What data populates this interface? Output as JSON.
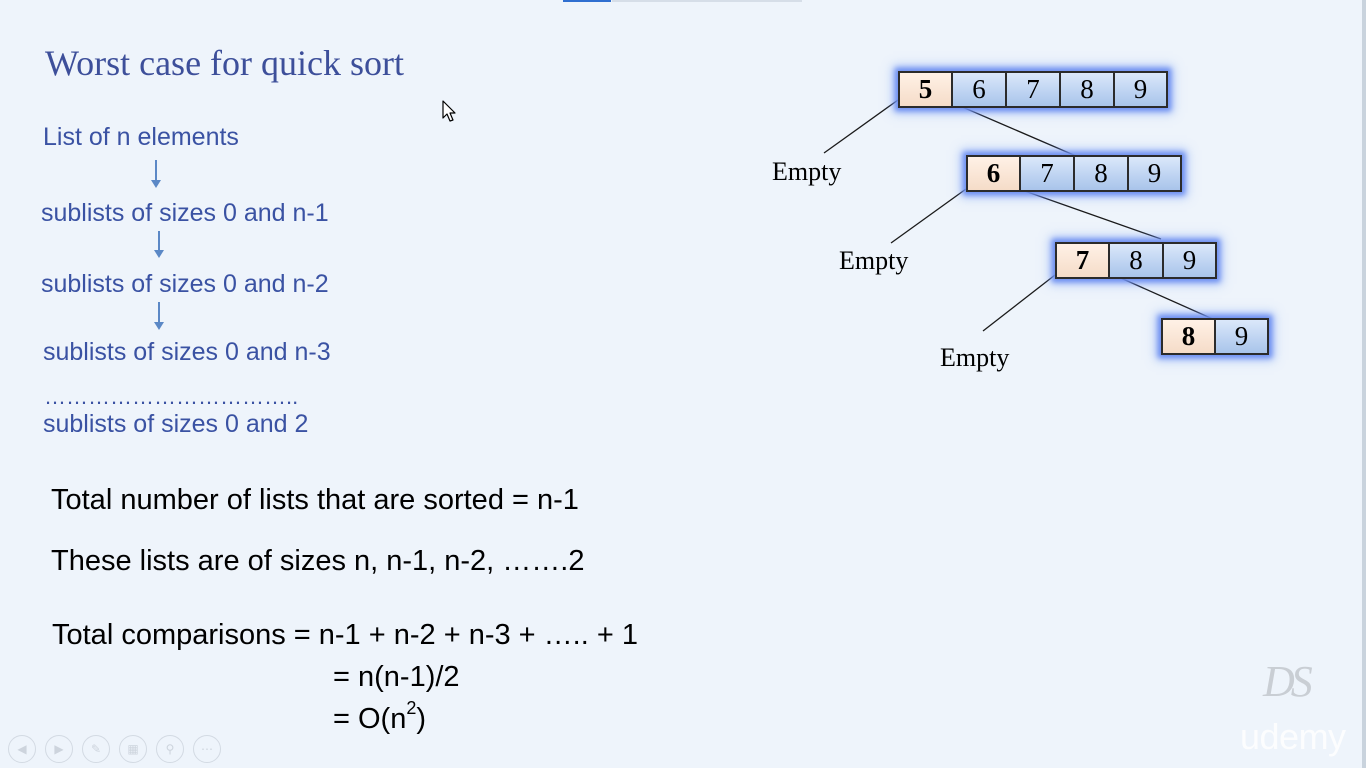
{
  "slide": {
    "title": "Worst case for quick sort",
    "flow": {
      "start": "List of n elements",
      "step1": "sublists of sizes 0 and n-1",
      "step2": "sublists of sizes 0 and n-2",
      "step3": "sublists of sizes 0 and n-3",
      "ellipsis": "……………………………..",
      "last": "sublists of sizes 0 and 2"
    },
    "summary": {
      "total_lists": "Total number of lists that are sorted =  n-1",
      "list_sizes": "These lists are of sizes n, n-1, n-2, …….2",
      "comparisons_line1": "Total comparisons =  n-1 +  n-2 +  n-3 + ….. + 1",
      "comparisons_eq2": "=   n(n-1)/2",
      "comparisons_eq3_prefix": "=   O(n",
      "comparisons_eq3_exp": "2",
      "comparisons_eq3_suffix": ")"
    },
    "diagram": {
      "empty_label": "Empty",
      "rows": [
        [
          "5",
          "6",
          "7",
          "8",
          "9"
        ],
        [
          "6",
          "7",
          "8",
          "9"
        ],
        [
          "7",
          "8",
          "9"
        ],
        [
          "8",
          "9"
        ]
      ]
    }
  },
  "player_controls": {
    "icons": [
      "prev-icon",
      "next-icon",
      "pen-icon",
      "slides-icon",
      "zoom-icon",
      "more-icon"
    ]
  },
  "branding": {
    "logo_text": "DS",
    "watermark": "udemy"
  }
}
